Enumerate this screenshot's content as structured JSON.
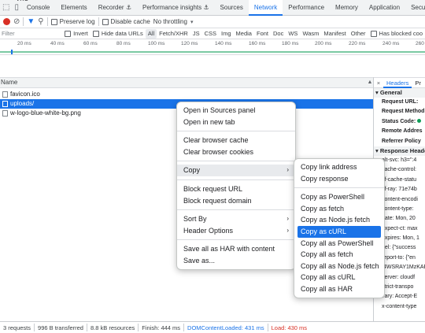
{
  "header": {
    "cut_text": "ЛЮ",
    "tabs": [
      "Console",
      "Elements",
      "Recorder ⚓",
      "Performance insights ⚓",
      "Sources",
      "Network",
      "Performance",
      "Memory",
      "Application",
      "Security"
    ],
    "active_tab": "Network"
  },
  "toolbar": {
    "preserve_log": "Preserve log",
    "disable_cache": "Disable cache",
    "throttling": "No throttling"
  },
  "filterbar": {
    "filter_placeholder": "Filter",
    "invert": "Invert",
    "hide_data_urls": "Hide data URLs",
    "types": [
      "All",
      "Fetch/XHR",
      "JS",
      "CSS",
      "Img",
      "Media",
      "Font",
      "Doc",
      "WS",
      "Wasm",
      "Manifest",
      "Other"
    ],
    "has_blocked": "Has blocked coo"
  },
  "timeline": {
    "ticks": [
      "20 ms",
      "40 ms",
      "60 ms",
      "80 ms",
      "100 ms",
      "120 ms",
      "140 ms",
      "160 ms",
      "180 ms",
      "200 ms",
      "220 ms",
      "240 ms",
      "260"
    ]
  },
  "requests": {
    "column_name": "Name",
    "rows": [
      "favicon.ico",
      "uploads/",
      "w-logo-blue-white-bg.png"
    ],
    "selected_index": 1
  },
  "side_panel": {
    "close": "×",
    "tabs": [
      "Headers",
      "Pr"
    ],
    "general_title": "▾ General",
    "general_lines": [
      "Request URL:",
      "Request Method",
      "Status Code:",
      "Remote Addres",
      "Referrer Policy"
    ],
    "response_title": "▾ Response Heade",
    "response_lines": [
      "alt-svc: h3=\":4",
      "cache-control: ",
      "cf-cache-statu",
      "cf-ray: 71e74b",
      "content-encodi",
      "content-type: ",
      "date: Mon, 20 ",
      "expect-ct: max",
      "expires: Mon, 1",
      "nel: {\"success",
      "report-to: {\"en",
      "I4WSRAY1MzKAR",
      "server: cloudf",
      "strict-transpo",
      "vary: Accept-E",
      "x-content-type"
    ]
  },
  "status": {
    "requests": "3 requests",
    "transferred": "996 B transferred",
    "resources": "8.8 kB resources",
    "finish": "Finish: 444 ms",
    "dcl": "DOMContentLoaded: 431 ms",
    "load": "Load: 430 ms"
  },
  "context_menu": {
    "group1": [
      "Open in Sources panel",
      "Open in new tab"
    ],
    "group2": [
      "Clear browser cache",
      "Clear browser cookies"
    ],
    "copy": "Copy",
    "group4": [
      "Block request URL",
      "Block request domain"
    ],
    "sort_by": "Sort By",
    "header_options": "Header Options",
    "group6": [
      "Save all as HAR with content",
      "Save as..."
    ]
  },
  "copy_submenu": {
    "group1": [
      "Copy link address",
      "Copy response"
    ],
    "group2": [
      "Copy as PowerShell",
      "Copy as fetch",
      "Copy as Node.js fetch",
      "Copy as cURL",
      "Copy all as PowerShell",
      "Copy all as fetch",
      "Copy all as Node.js fetch",
      "Copy all as cURL",
      "Copy all as HAR"
    ],
    "highlighted": "Copy as cURL"
  },
  "colors": {
    "accent": "#1a73e8",
    "record": "#d93025",
    "timeline": "#0f9d58"
  }
}
